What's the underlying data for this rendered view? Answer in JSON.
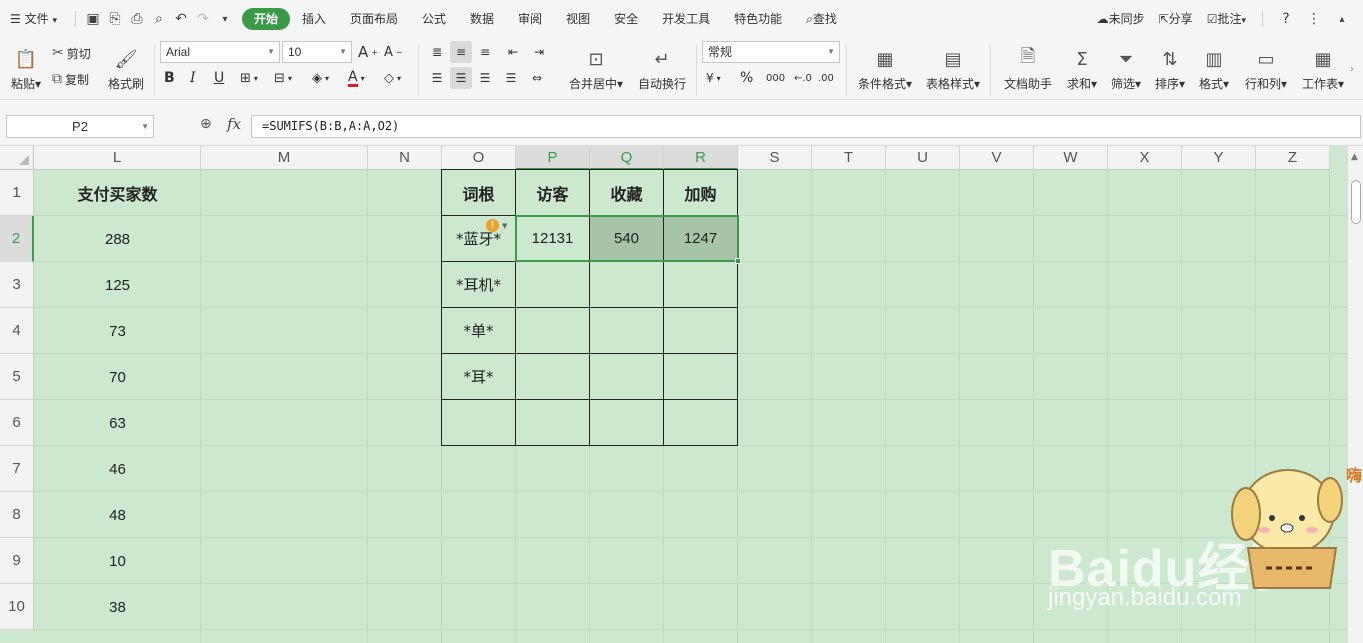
{
  "menubar": {
    "file": "文件",
    "tabs": [
      "开始",
      "插入",
      "页面布局",
      "公式",
      "数据",
      "审阅",
      "视图",
      "安全",
      "开发工具",
      "特色功能"
    ],
    "search": "查找",
    "sync": "未同步",
    "share": "分享",
    "comment": "批注"
  },
  "ribbon": {
    "paste": "粘贴",
    "cut": "剪切",
    "copy": "复制",
    "format_painter": "格式刷",
    "font_name": "Arial",
    "font_size": "10",
    "merge_center": "合并居中",
    "wrap_text": "自动换行",
    "number_format": "常规",
    "cond_format": "条件格式",
    "table_style": "表格样式",
    "doc_assistant": "文档助手",
    "sum": "求和",
    "filter": "筛选",
    "sort": "排序",
    "format": "格式",
    "row_col": "行和列",
    "worksheet": "工作表"
  },
  "formula_bar": {
    "name_box": "P2",
    "fx": "fx",
    "formula": "=SUMIFS(B:B,A:A,O2)"
  },
  "sheet": {
    "columns": [
      "L",
      "M",
      "N",
      "O",
      "P",
      "Q",
      "R",
      "S",
      "T",
      "U",
      "V",
      "W",
      "X",
      "Y",
      "Z"
    ],
    "rows": [
      "1",
      "2",
      "3",
      "4",
      "5",
      "6",
      "7",
      "8",
      "9",
      "10"
    ],
    "col_L": {
      "header": "支付买家数",
      "values": [
        "288",
        "125",
        "73",
        "70",
        "63",
        "46",
        "48",
        "10",
        "38"
      ]
    },
    "table": {
      "headers": [
        "词根",
        "访客",
        "收藏",
        "加购"
      ],
      "rows": [
        [
          "*蓝牙*",
          "12131",
          "540",
          "1247"
        ],
        [
          "*耳机*",
          "",
          "",
          ""
        ],
        [
          "*单*",
          "",
          "",
          ""
        ],
        [
          "*耳*",
          "",
          "",
          ""
        ],
        [
          "",
          "",
          "",
          ""
        ]
      ]
    }
  },
  "watermark": {
    "logo": "Baidu经验",
    "url": "jingyan.baidu.com",
    "greeting": "嗨"
  }
}
